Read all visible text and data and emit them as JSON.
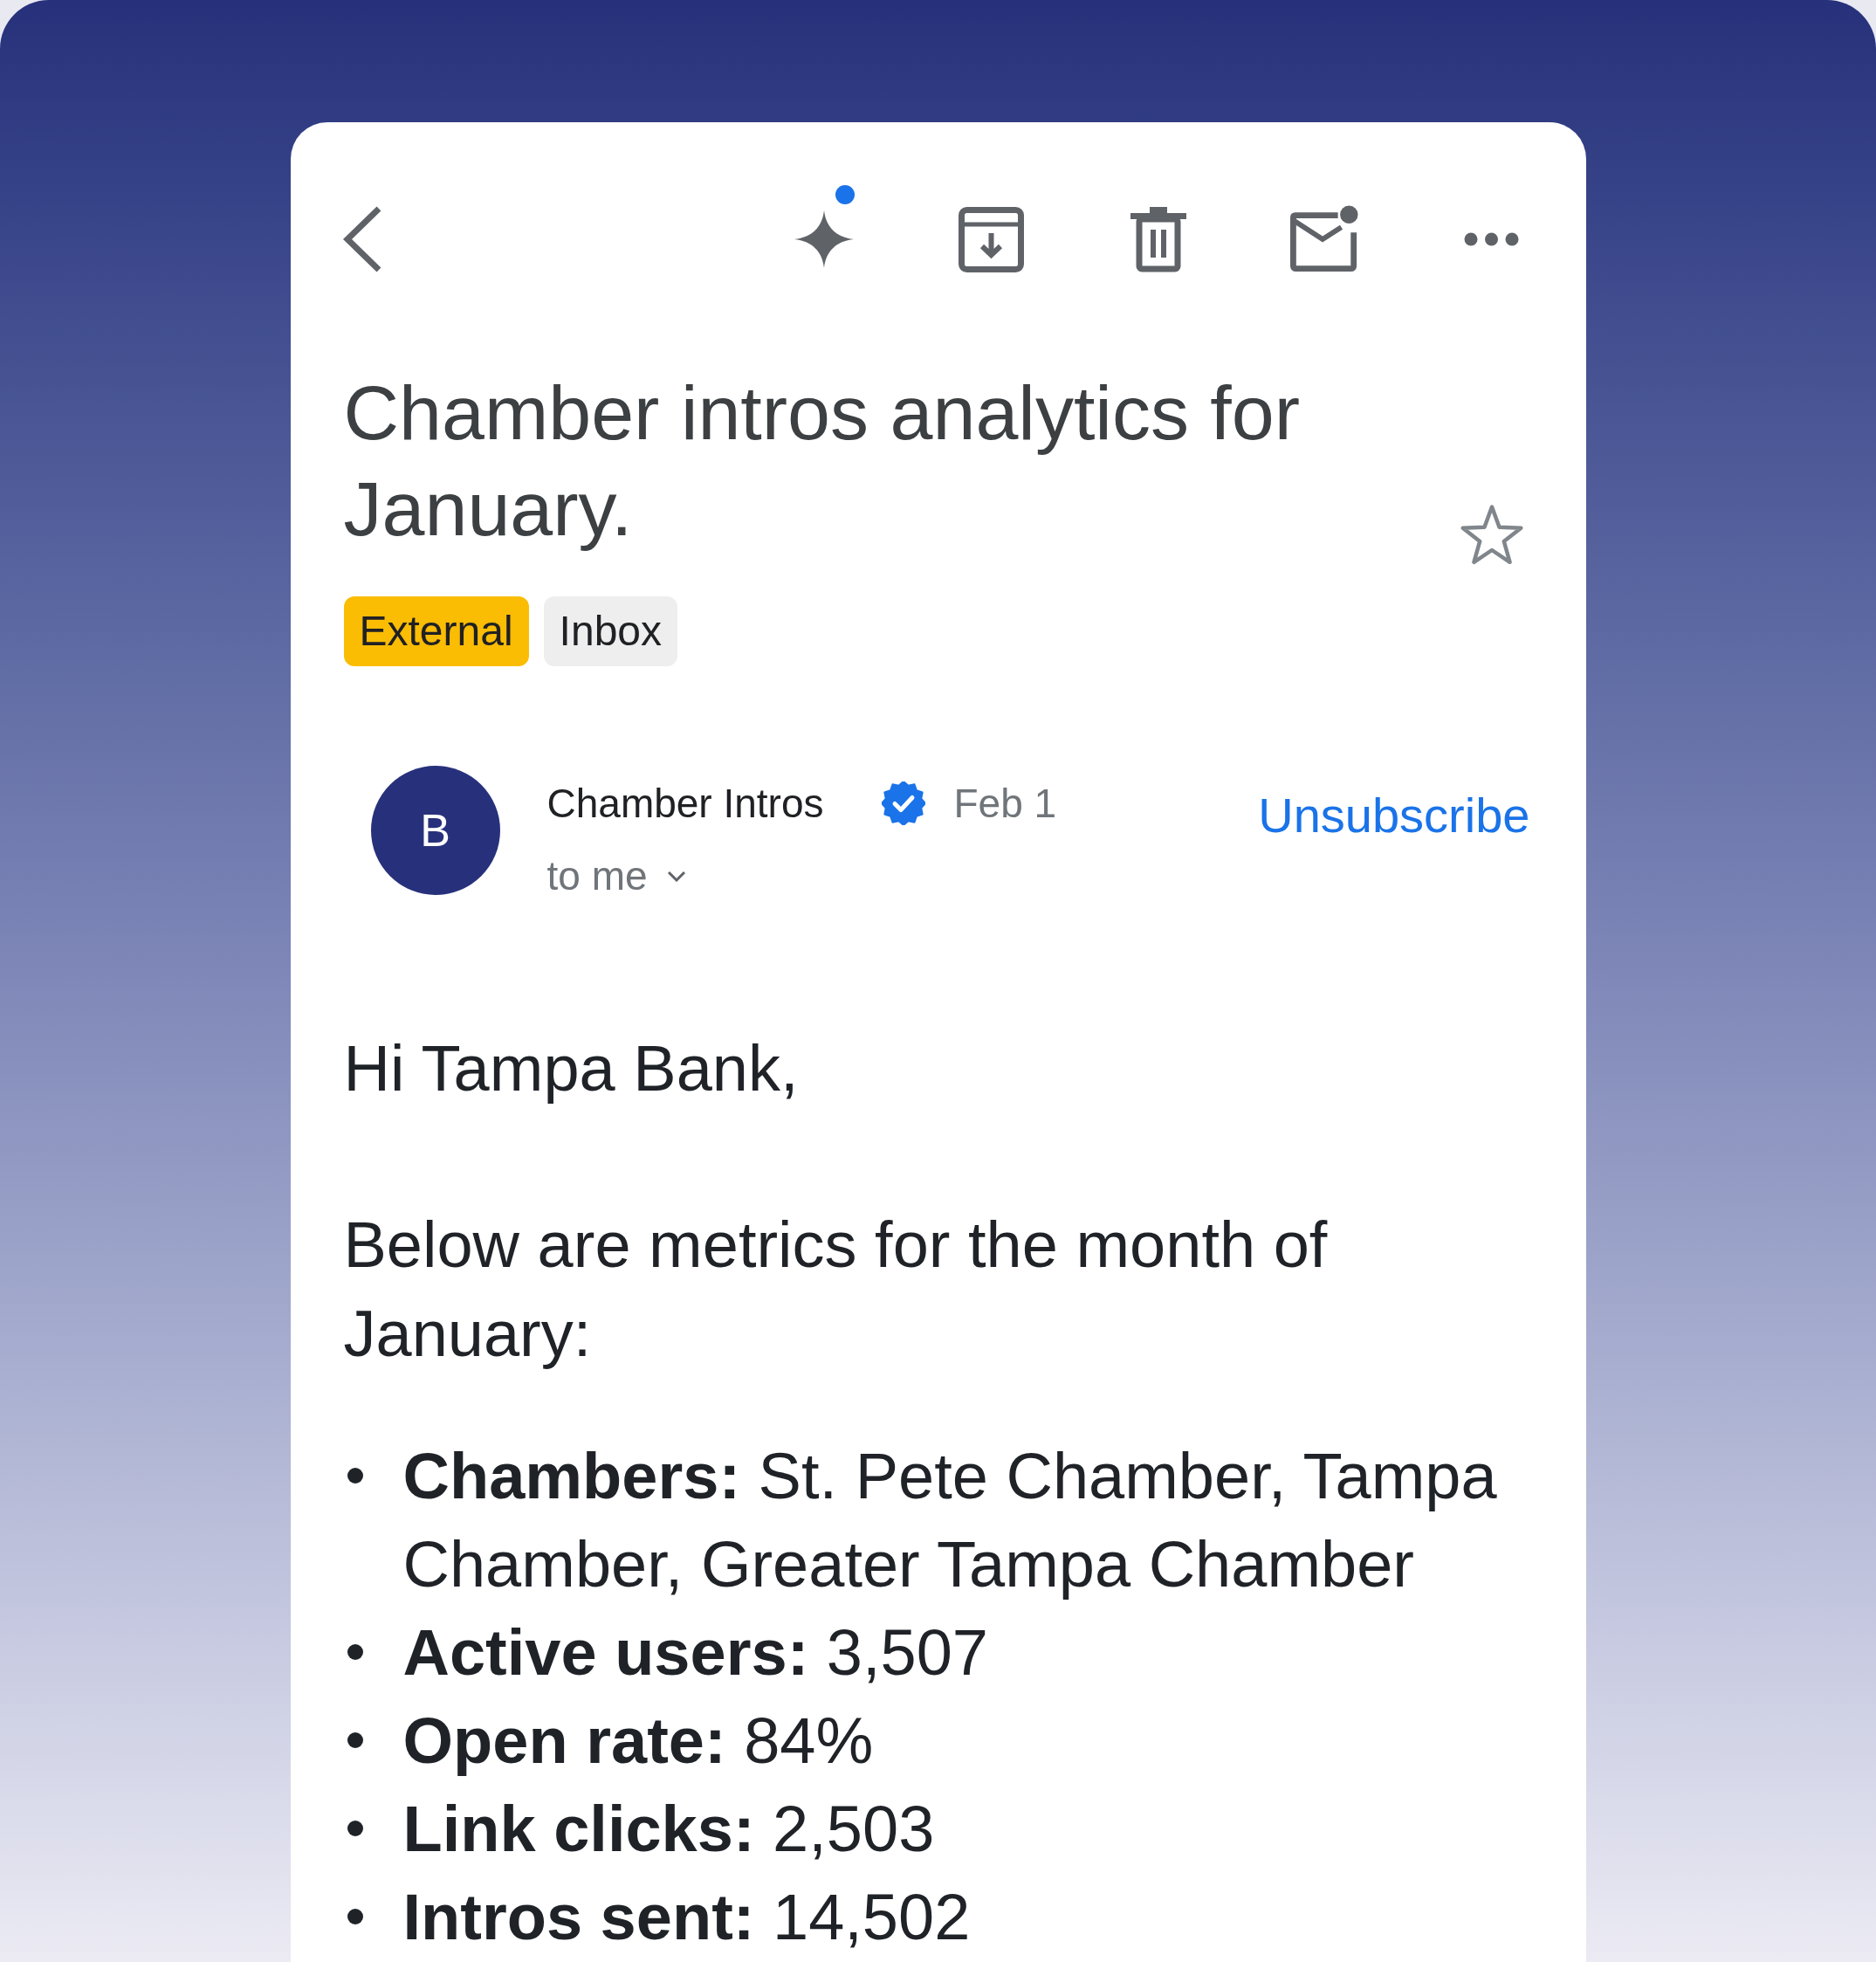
{
  "subject": "Chamber intros analytics for January.",
  "starred": false,
  "labels": [
    {
      "text": "External",
      "color": "#fbbc04"
    },
    {
      "text": "Inbox",
      "color": "#eeeeee"
    }
  ],
  "sender": {
    "initial": "B",
    "name": "Chamber Intros",
    "verified": true,
    "date": "Feb 1",
    "recipients": "to me"
  },
  "unsubscribe": "Unsubscribe",
  "body": {
    "greeting": "Hi Tampa Bank,",
    "intro": "Below are metrics for the month of January:",
    "metrics": [
      "**Chambers:** St. Pete Chamber, Tampa Chamber, Greater Tampa Chamber",
      "**Active users:** 3,507",
      "**Open rate:** 84%",
      "**Link clicks:** 2,503",
      "**Intros sent:** 14,502"
    ]
  }
}
